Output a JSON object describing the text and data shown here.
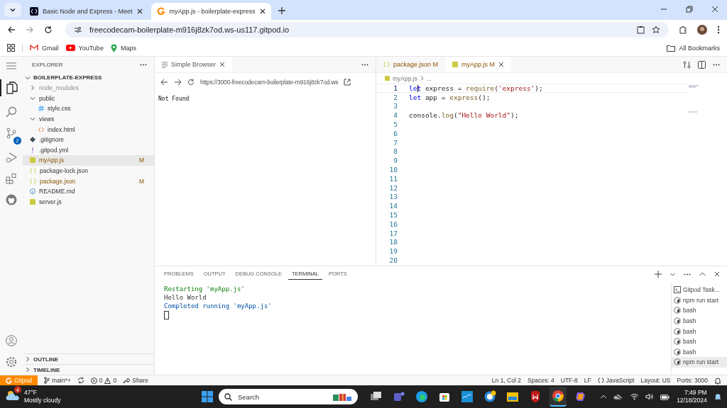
{
  "browser": {
    "tabs": [
      {
        "title": "Basic Node and Express - Meet",
        "selected": false
      },
      {
        "title": "myApp.js - boilerplate-express",
        "selected": true
      }
    ],
    "address": "freecodecam-boilerplate-m916j8zk7od.ws-us117.gitpod.io",
    "bookmarks": [
      {
        "kind": "gmail",
        "label": "Gmail"
      },
      {
        "kind": "youtube",
        "label": "YouTube"
      },
      {
        "kind": "maps",
        "label": "Maps"
      }
    ],
    "all_bookmarks": "All Bookmarks"
  },
  "activity_bar": {
    "source_control_badge": "2"
  },
  "explorer": {
    "title": "EXPLORER",
    "root": "BOILERPLATE-EXPRESS",
    "tree": [
      {
        "kind": "folder",
        "name": "node_modules",
        "expanded": false,
        "selected": false,
        "dim": true
      },
      {
        "kind": "folder",
        "name": "public",
        "expanded": true,
        "selected": false,
        "children": [
          {
            "kind": "css",
            "name": "style.css",
            "selected": false
          }
        ]
      },
      {
        "kind": "folder",
        "name": "views",
        "expanded": true,
        "selected": false,
        "children": [
          {
            "kind": "html",
            "name": "index.html",
            "selected": false
          }
        ]
      },
      {
        "kind": "git",
        "name": ".gitignore",
        "selected": false
      },
      {
        "kind": "yaml",
        "name": ".gitpod.yml",
        "selected": false
      },
      {
        "kind": "js",
        "name": "myApp.js",
        "badge": "M",
        "selected": true
      },
      {
        "kind": "json",
        "name": "package-lock.json",
        "selected": false
      },
      {
        "kind": "json",
        "name": "package.json",
        "badge": "M",
        "selected": false
      },
      {
        "kind": "info",
        "name": "README.md",
        "selected": false
      },
      {
        "kind": "js",
        "name": "server.js",
        "selected": false
      }
    ],
    "sections": [
      "OUTLINE",
      "TIMELINE"
    ]
  },
  "simple_browser": {
    "tab": "Simple Browser",
    "url": "https://3000-freecodecam-boilerplate-m916j8zk7od.ws",
    "content": "Not Found"
  },
  "editor": {
    "tabs": [
      {
        "kind": "json",
        "label": "package.json",
        "badge": "M",
        "selected": false
      },
      {
        "kind": "js",
        "label": "myApp.js",
        "badge": "M",
        "selected": true
      }
    ],
    "breadcrumb": [
      "myApp.js",
      "..."
    ],
    "lines": [
      {
        "number": "1",
        "current": true,
        "tokens": [
          {
            "kind": "keyword",
            "text": "let"
          },
          {
            "kind": "plain",
            "text": " express = "
          },
          {
            "kind": "function",
            "text": "require"
          },
          {
            "kind": "plain",
            "text": "("
          },
          {
            "kind": "string",
            "text": "'express'"
          },
          {
            "kind": "plain",
            "text": ");"
          }
        ]
      },
      {
        "number": "2",
        "current": false,
        "tokens": [
          {
            "kind": "keyword",
            "text": "let"
          },
          {
            "kind": "plain",
            "text": " app = "
          },
          {
            "kind": "function",
            "text": "express"
          },
          {
            "kind": "plain",
            "text": "();"
          }
        ]
      },
      {
        "number": "3",
        "current": false
      },
      {
        "number": "4",
        "current": false,
        "tokens": [
          {
            "kind": "plain",
            "text": "console."
          },
          {
            "kind": "function",
            "text": "log"
          },
          {
            "kind": "plain",
            "text": "("
          },
          {
            "kind": "string",
            "text": "\"Hello World\""
          },
          {
            "kind": "plain",
            "text": ");"
          }
        ]
      },
      {
        "number": "5",
        "current": false
      },
      {
        "number": "6",
        "current": false
      },
      {
        "number": "7",
        "current": false
      },
      {
        "number": "8",
        "current": false
      },
      {
        "number": "9",
        "current": false
      },
      {
        "number": "10",
        "current": false
      },
      {
        "number": "11",
        "current": false
      },
      {
        "number": "12",
        "current": false
      },
      {
        "number": "13",
        "current": false
      },
      {
        "number": "14",
        "current": false
      },
      {
        "number": "15",
        "current": false
      },
      {
        "number": "16",
        "current": false
      },
      {
        "number": "17",
        "current": false
      },
      {
        "number": "18",
        "current": false
      },
      {
        "number": "19",
        "current": false
      },
      {
        "number": "20",
        "current": false
      }
    ]
  },
  "panel": {
    "tabs": [
      {
        "label": "PROBLEMS",
        "selected": false
      },
      {
        "label": "OUTPUT",
        "selected": false
      },
      {
        "label": "DEBUG CONSOLE",
        "selected": false
      },
      {
        "label": "TERMINAL",
        "selected": true
      },
      {
        "label": "PORTS",
        "selected": false
      }
    ],
    "terminal": [
      {
        "kind": "success",
        "text": "Restarting 'myApp.js'"
      },
      {
        "kind": "plain",
        "text": "Hello World"
      },
      {
        "kind": "info",
        "text": "Completed running 'myApp.js'"
      }
    ],
    "terminals": [
      {
        "kind": "task",
        "name": "Gitpod Task...",
        "selected": false
      },
      {
        "kind": "shell",
        "name": "npm run start",
        "selected": false
      },
      {
        "kind": "shell",
        "name": "bash",
        "selected": false
      },
      {
        "kind": "shell",
        "name": "bash",
        "selected": false
      },
      {
        "kind": "shell",
        "name": "bash",
        "selected": false
      },
      {
        "kind": "shell",
        "name": "bash",
        "selected": false
      },
      {
        "kind": "shell",
        "name": "bash",
        "selected": false
      },
      {
        "kind": "shell",
        "name": "npm run start",
        "selected": true
      }
    ]
  },
  "status_bar": {
    "remote": "Gitpod",
    "branch": "main*+",
    "errors": "0",
    "warnings": "0",
    "share": "Share",
    "right": [
      "Ln 1, Col 2",
      "Spaces: 4",
      "UTF-8",
      "LF",
      "JavaScript",
      "Layout: US",
      "Ports: 3000"
    ]
  },
  "taskbar": {
    "weather_badge": "4",
    "temperature": "47°F",
    "weather": "Mostly cloudy",
    "search": "Search",
    "apps": [
      {
        "selected": false
      },
      {
        "selected": false
      },
      {
        "selected": false
      },
      {
        "selected": false
      },
      {
        "selected": false
      },
      {
        "selected": false
      },
      {
        "selected": false
      },
      {
        "selected": false
      },
      {
        "selected": true
      },
      {
        "selected": false
      }
    ],
    "time": "7:49 PM",
    "date": "12/18/2024"
  }
}
